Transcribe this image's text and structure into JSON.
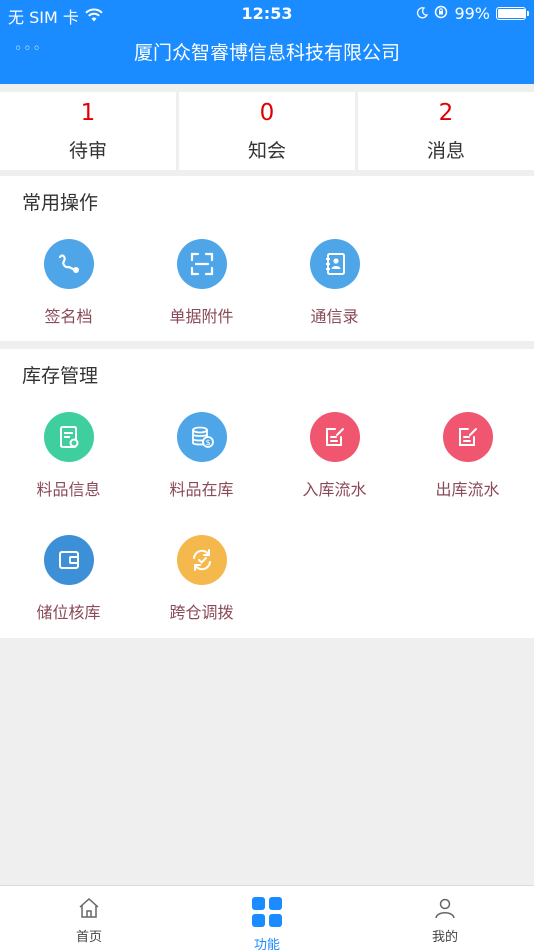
{
  "status_bar": {
    "carrier": "无 SIM 卡",
    "time": "12:53",
    "battery_pct": "99%",
    "battery_level": 0.99
  },
  "nav": {
    "more": "◦◦◦",
    "title": "厦门众智睿博信息科技有限公司"
  },
  "counts": [
    {
      "value": "1",
      "label": "待审"
    },
    {
      "value": "0",
      "label": "知会"
    },
    {
      "value": "2",
      "label": "消息"
    }
  ],
  "common": {
    "title": "常用操作",
    "items": [
      {
        "label": "签名档",
        "icon": "signature-icon",
        "color": "#4ea6e8"
      },
      {
        "label": "单据附件",
        "icon": "scan-icon",
        "color": "#4ea6e8"
      },
      {
        "label": "通信录",
        "icon": "contacts-icon",
        "color": "#4ea6e8"
      }
    ]
  },
  "inventory": {
    "title": "库存管理",
    "items": [
      {
        "label": "料品信息",
        "icon": "document-icon",
        "color": "#3fcf9f"
      },
      {
        "label": "料品在库",
        "icon": "coins-icon",
        "color": "#4ea6e8"
      },
      {
        "label": "入库流水",
        "icon": "edit-icon",
        "color": "#f0566f"
      },
      {
        "label": "出库流水",
        "icon": "edit-icon",
        "color": "#f0566f"
      },
      {
        "label": "储位核库",
        "icon": "wallet-icon",
        "color": "#3d8fd8"
      },
      {
        "label": "跨仓调拨",
        "icon": "transfer-icon",
        "color": "#f5b84c"
      }
    ]
  },
  "tabs": [
    {
      "label": "首页",
      "icon": "home-icon"
    },
    {
      "label": "功能",
      "icon": "grid-icon"
    },
    {
      "label": "我的",
      "icon": "user-icon"
    }
  ],
  "colors": {
    "header": "#1a8cff",
    "count_value": "#e00000",
    "item_label": "#8a4a57",
    "active_tab": "#1a8cff"
  }
}
